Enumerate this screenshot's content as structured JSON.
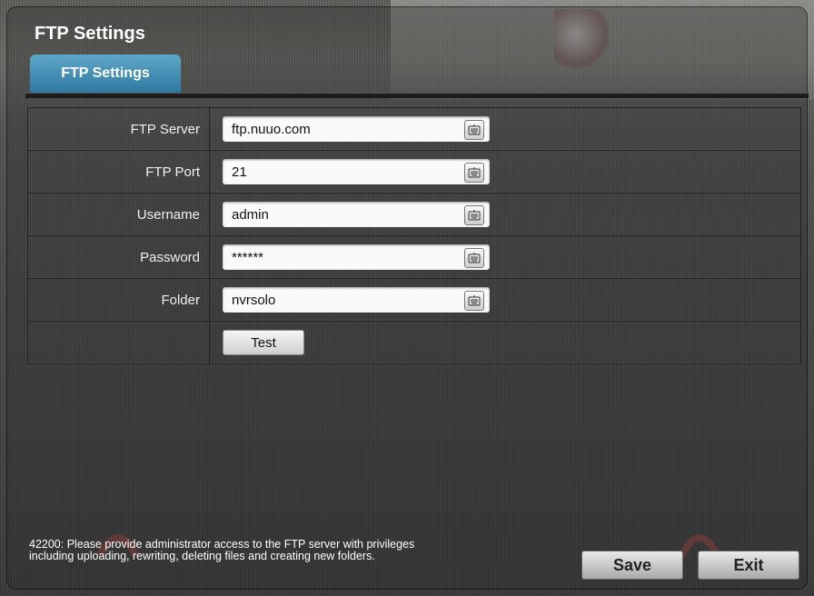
{
  "window": {
    "title": "FTP Settings"
  },
  "tabs": [
    {
      "label": "FTP Settings",
      "active": true
    }
  ],
  "form": {
    "rows": [
      {
        "label": "FTP Server",
        "value": "ftp.nuuo.com"
      },
      {
        "label": "FTP Port",
        "value": "21"
      },
      {
        "label": "Username",
        "value": "admin"
      },
      {
        "label": "Password",
        "value": "******"
      },
      {
        "label": "Folder",
        "value": "nvrsolo"
      }
    ],
    "test_label": "Test"
  },
  "footer": {
    "note": "42200: Please provide administrator access to the FTP server with privileges including uploading, rewriting, deleting files and creating new folders.",
    "save_label": "Save",
    "exit_label": "Exit"
  },
  "icons": {
    "keyboard": "keyboard-icon"
  },
  "colors": {
    "tab_accent": "#3a86b0"
  }
}
